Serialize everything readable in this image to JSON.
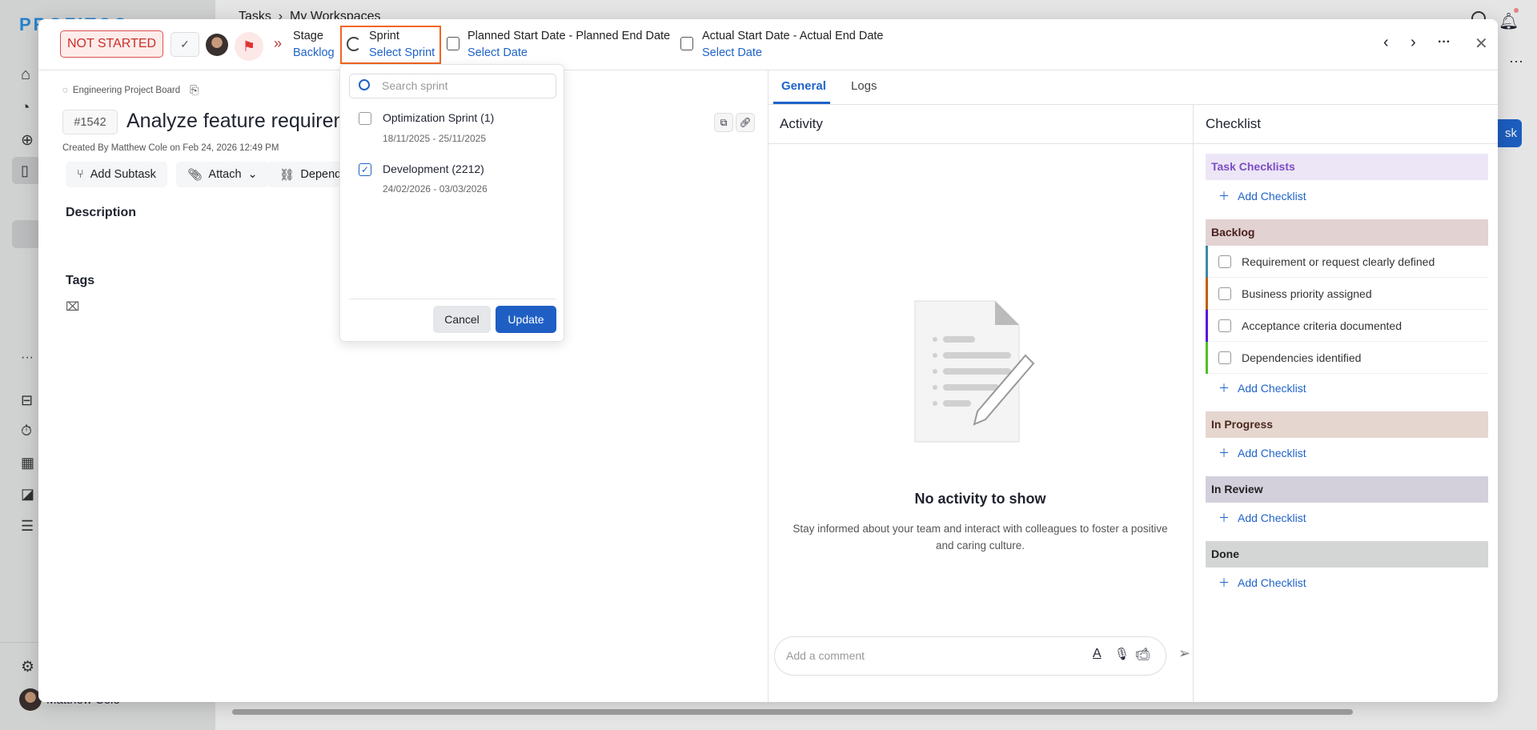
{
  "app": {
    "logo": "PROFITCO",
    "breadcrumb": [
      "Tasks",
      "My Workspaces"
    ],
    "user_name": "Matthew Cole",
    "bg_button": "sk"
  },
  "header": {
    "status": "NOT STARTED",
    "stage_label": "Stage",
    "stage_value": "Backlog",
    "sprint_label": "Sprint",
    "sprint_value": "Select Sprint",
    "planned_label": "Planned Start Date - Planned End Date",
    "planned_value": "Select Date",
    "actual_label": "Actual Start Date - Actual End Date",
    "actual_value": "Select Date"
  },
  "sprint_dropdown": {
    "placeholder": "Search sprint",
    "items": [
      {
        "name": "Optimization Sprint (1)",
        "dates": "18/11/2025 - 25/11/2025",
        "checked": false
      },
      {
        "name": "Development (2212)",
        "dates": "24/02/2026 - 03/03/2026",
        "checked": true
      }
    ],
    "cancel": "Cancel",
    "update": "Update"
  },
  "task": {
    "board": "Engineering Project Board",
    "id": "#1542",
    "title": "Analyze feature requirem",
    "created": "Created By Matthew Cole on Feb 24, 2026 12:49 PM",
    "add_subtask": "Add Subtask",
    "attach": "Attach",
    "depend": "Depend",
    "description": "Description",
    "tags": "Tags"
  },
  "tabs": [
    "General",
    "Logs"
  ],
  "activity": {
    "title": "Activity",
    "empty_title": "No activity to show",
    "empty_line1": "Stay informed about your team and interact with colleagues to foster a positive",
    "empty_line2": "and caring culture.",
    "comment_placeholder": "Add a comment"
  },
  "checklist": {
    "title": "Checklist",
    "add": "Add Checklist",
    "sections": {
      "task": "Task Checklists",
      "backlog": "Backlog",
      "in_progress": "In Progress",
      "in_review": "In Review",
      "done": "Done"
    },
    "backlog_items": [
      "Requirement or request clearly defined",
      "Business priority assigned",
      "Acceptance criteria documented",
      "Dependencies identified"
    ],
    "colors": {
      "task": "#ece6f6",
      "backlog": "#e2d2d2",
      "in_progress": "#e6d6d0",
      "in_review": "#d3d0dc",
      "done": "#d4d6d5"
    }
  },
  "accent": "#1f63c9"
}
